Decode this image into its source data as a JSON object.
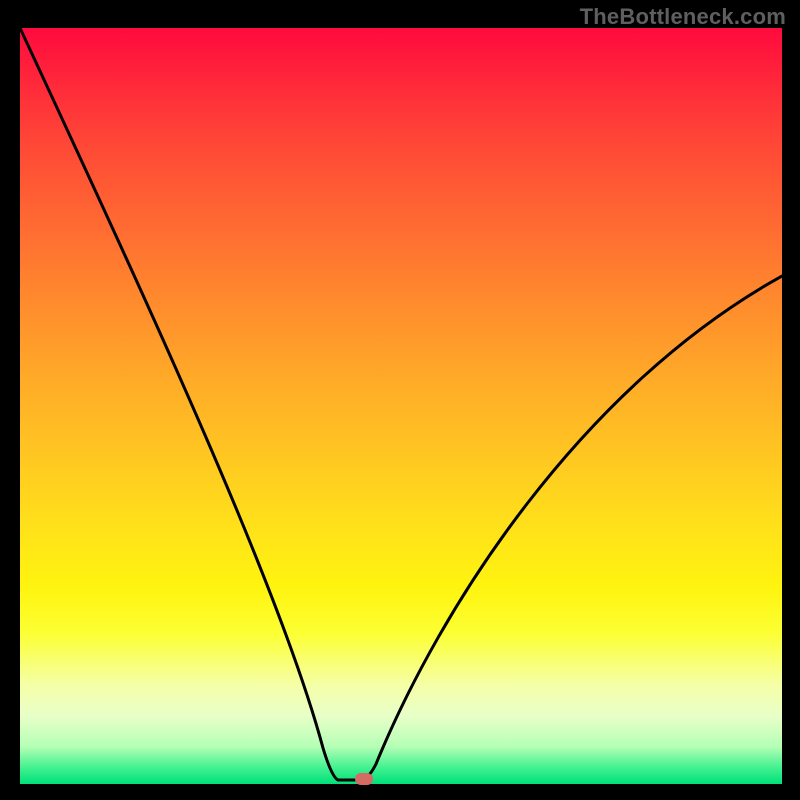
{
  "watermark": "TheBottleneck.com",
  "marker": {
    "style": "left:355px; top:773px; background:#d66a64;"
  },
  "chart_data": {
    "type": "line",
    "title": "",
    "xlabel": "",
    "ylabel": "",
    "xlim": [
      0,
      100
    ],
    "ylim": [
      0,
      100
    ],
    "grid": false,
    "legend": false,
    "series": [
      {
        "name": "bottleneck-curve",
        "x": [
          0,
          5,
          10,
          15,
          20,
          25,
          30,
          35,
          38,
          40,
          42,
          44,
          45,
          46,
          48,
          52,
          56,
          60,
          65,
          70,
          75,
          80,
          85,
          90,
          95,
          100
        ],
        "values": [
          100,
          89,
          78,
          67,
          56,
          45,
          33,
          20,
          11,
          5,
          1,
          0,
          0,
          0,
          3,
          10,
          18,
          26,
          34,
          42,
          49,
          55,
          60,
          63,
          65,
          67
        ]
      }
    ],
    "annotations": [
      {
        "name": "optimal-point",
        "x": 45,
        "y": 0,
        "shape": "pill",
        "color": "#d66a64"
      }
    ],
    "background_gradient": {
      "direction": "vertical",
      "stops": [
        {
          "pct": 0,
          "color": "#ff0a3e"
        },
        {
          "pct": 26,
          "color": "#ff6a32"
        },
        {
          "pct": 56,
          "color": "#ffc522"
        },
        {
          "pct": 80,
          "color": "#fcff33"
        },
        {
          "pct": 95,
          "color": "#b6ffb6"
        },
        {
          "pct": 100,
          "color": "#00e07a"
        }
      ]
    },
    "watermark": "TheBottleneck.com"
  }
}
